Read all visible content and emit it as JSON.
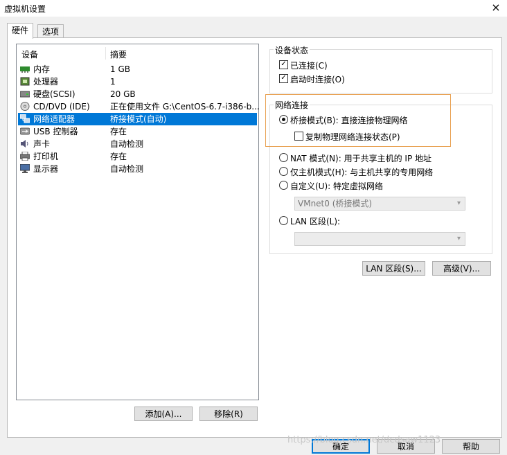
{
  "window": {
    "title": "虚拟机设置",
    "close_icon": "×"
  },
  "tabs": [
    {
      "label": "硬件"
    },
    {
      "label": "选项"
    }
  ],
  "device_list": {
    "headers": {
      "device": "设备",
      "summary": "摘要"
    },
    "rows": [
      {
        "name": "内存",
        "summary": "1 GB",
        "icon": "memory-icon"
      },
      {
        "name": "处理器",
        "summary": "1",
        "icon": "processor-icon"
      },
      {
        "name": "硬盘(SCSI)",
        "summary": "20 GB",
        "icon": "harddisk-icon"
      },
      {
        "name": "CD/DVD (IDE)",
        "summary": "正在使用文件 G:\\CentOS-6.7-i386-b...",
        "icon": "cd-dvd-icon"
      },
      {
        "name": "网络适配器",
        "summary": "桥接模式(自动)",
        "icon": "network-adapter-icon",
        "selected": true
      },
      {
        "name": "USB 控制器",
        "summary": "存在",
        "icon": "usb-icon"
      },
      {
        "name": "声卡",
        "summary": "自动检测",
        "icon": "sound-card-icon"
      },
      {
        "name": "打印机",
        "summary": "存在",
        "icon": "printer-icon"
      },
      {
        "name": "显示器",
        "summary": "自动检测",
        "icon": "display-icon"
      }
    ]
  },
  "list_buttons": {
    "add": "添加(A)...",
    "remove": "移除(R)"
  },
  "device_status": {
    "title": "设备状态",
    "connected": {
      "label": "已连接(C)",
      "checked": true
    },
    "connect_at_power_on": {
      "label": "启动时连接(O)",
      "checked": true
    }
  },
  "network": {
    "title": "网络连接",
    "bridged": {
      "label": "桥接模式(B): 直接连接物理网络",
      "selected": true
    },
    "replicate": {
      "label": "复制物理网络连接状态(P)",
      "checked": false
    },
    "nat": {
      "label": "NAT 模式(N): 用于共享主机的 IP 地址",
      "selected": false
    },
    "host_only": {
      "label": "仅主机模式(H): 与主机共享的专用网络",
      "selected": false
    },
    "custom": {
      "label": "自定义(U): 特定虚拟网络",
      "selected": false
    },
    "custom_select_value": "VMnet0 (桥接模式)",
    "lan_segment": {
      "label": "LAN 区段(L):",
      "selected": false
    },
    "lan_select_value": ""
  },
  "right_buttons": {
    "lan_segments": "LAN 区段(S)...",
    "advanced": "高级(V)..."
  },
  "footer": {
    "ok": "确定",
    "cancel": "取消",
    "help": "帮助"
  },
  "watermark": "https://blog.csdn.net/dcdsaw1123",
  "colors": {
    "selection": "#0078d7",
    "highlight_box": "#e8a050"
  }
}
